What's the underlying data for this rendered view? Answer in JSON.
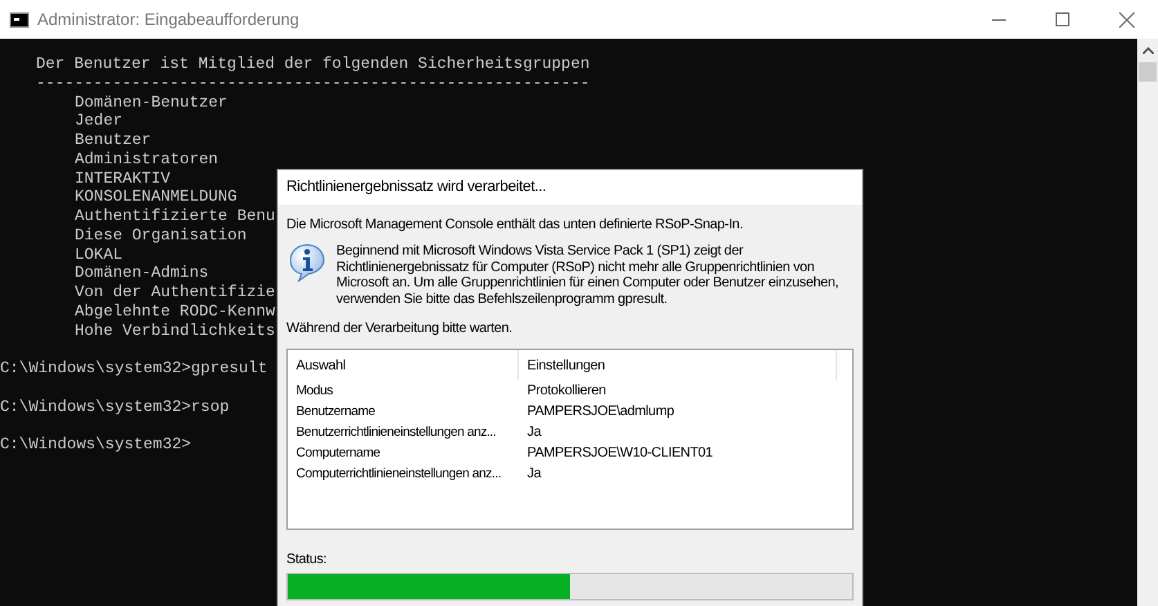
{
  "window": {
    "title": "Administrator: Eingabeaufforderung"
  },
  "console": {
    "lines": [
      {
        "kind": "indent1",
        "text": "Der Benutzer ist Mitglied der folgenden Sicherheitsgruppen"
      },
      {
        "kind": "indent1",
        "text": "----------------------------------------------------------"
      },
      {
        "kind": "indent2",
        "text": "Domänen-Benutzer"
      },
      {
        "kind": "indent2",
        "text": "Jeder"
      },
      {
        "kind": "indent2",
        "text": "Benutzer"
      },
      {
        "kind": "indent2",
        "text": "Administratoren"
      },
      {
        "kind": "indent2",
        "text": "INTERAKTIV"
      },
      {
        "kind": "indent2",
        "text": "KONSOLENANMELDUNG"
      },
      {
        "kind": "indent2",
        "text": "Authentifizierte Benu"
      },
      {
        "kind": "indent2",
        "text": "Diese Organisation"
      },
      {
        "kind": "indent2",
        "text": "LOKAL"
      },
      {
        "kind": "indent2",
        "text": "Domänen-Admins"
      },
      {
        "kind": "indent2",
        "text": "Von der Authentifizie"
      },
      {
        "kind": "indent2",
        "text": "Abgelehnte RODC-Kennw"
      },
      {
        "kind": "indent2",
        "text": "Hohe Verbindlichkeits"
      },
      {
        "kind": "blank"
      },
      {
        "kind": "prompt",
        "text": "C:\\Windows\\system32>gpresult"
      },
      {
        "kind": "blank"
      },
      {
        "kind": "prompt",
        "text": "C:\\Windows\\system32>rsop"
      },
      {
        "kind": "blank"
      },
      {
        "kind": "prompt",
        "text": "C:\\Windows\\system32>"
      }
    ]
  },
  "dialog": {
    "title": "Richtlinienergebnissatz wird verarbeitet...",
    "intro": "Die Microsoft Management Console enthält das unten definierte RSoP-Snap-In.",
    "info": "Beginnend mit Microsoft Windows Vista Service Pack 1 (SP1) zeigt der Richtlinienergebnissatz für Computer (RSoP) nicht mehr alle Gruppenrichtlinien von Microsoft an. Um alle Gruppenrichtlinien für einen Computer oder Benutzer einzusehen, verwenden Sie bitte das Befehlszeilenprogramm gpresult.",
    "wait": "Während der Verarbeitung bitte warten.",
    "table": {
      "columns": [
        "Auswahl",
        "Einstellungen"
      ],
      "rows": [
        [
          "Modus",
          "Protokollieren"
        ],
        [
          "Benutzername",
          "PAMPERSJOE\\admlump"
        ],
        [
          "Benutzerrichtlinieneinstellungen anz...",
          "Ja"
        ],
        [
          "Computername",
          "PAMPERSJOE\\W10-CLIENT01"
        ],
        [
          "Computerrichtlinieneinstellungen anz...",
          "Ja"
        ]
      ]
    },
    "status": {
      "label": "Status:",
      "level": 0.5
    }
  }
}
